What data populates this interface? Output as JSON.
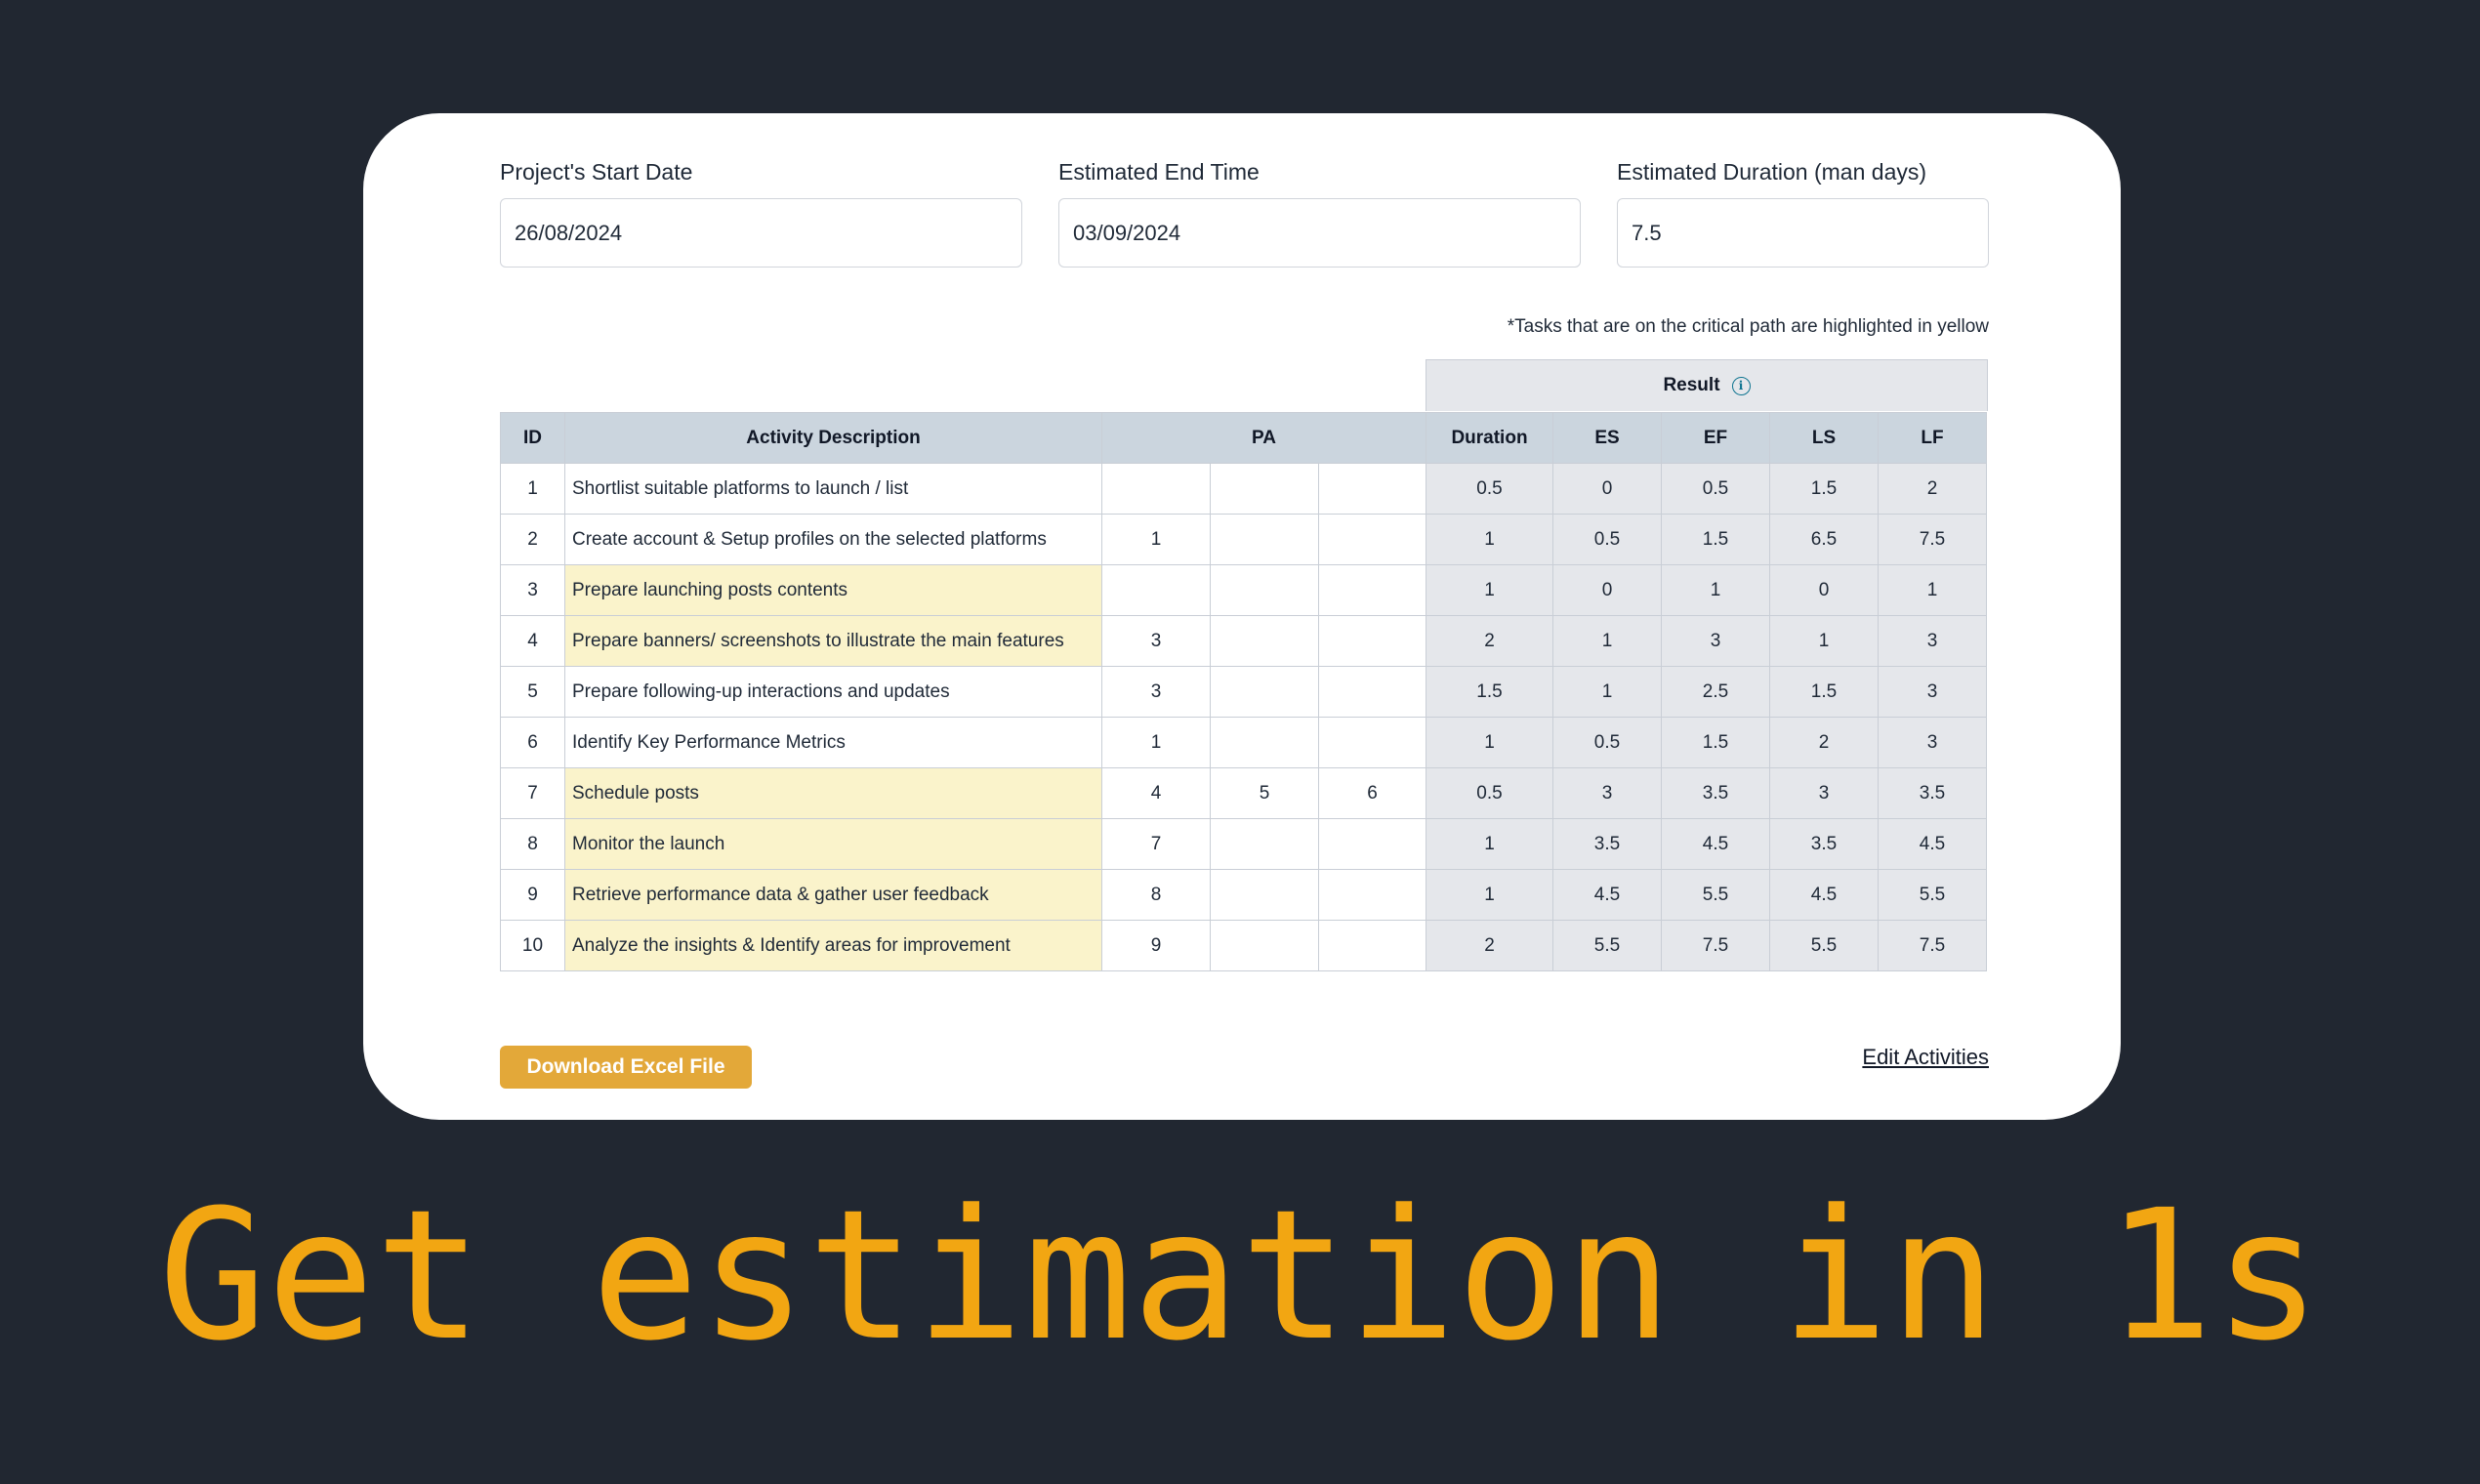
{
  "form": {
    "start_date_label": "Project's Start Date",
    "start_date_value": "26/08/2024",
    "end_time_label": "Estimated End Time",
    "end_time_value": "03/09/2024",
    "duration_label": "Estimated Duration (man days)",
    "duration_value": "7.5"
  },
  "note": "*Tasks that are on the critical path are highlighted in yellow",
  "table": {
    "result_header": "Result",
    "info_icon": "i",
    "headers": {
      "id": "ID",
      "description": "Activity Description",
      "pa": "PA",
      "duration": "Duration",
      "es": "ES",
      "ef": "EF",
      "ls": "LS",
      "lf": "LF"
    },
    "rows": [
      {
        "id": "1",
        "desc": "Shortlist suitable platforms to launch / list",
        "pa": [
          "",
          "",
          ""
        ],
        "duration": "0.5",
        "es": "0",
        "ef": "0.5",
        "ls": "1.5",
        "lf": "2",
        "critical": false
      },
      {
        "id": "2",
        "desc": "Create account & Setup profiles on the selected platforms",
        "pa": [
          "1",
          "",
          ""
        ],
        "duration": "1",
        "es": "0.5",
        "ef": "1.5",
        "ls": "6.5",
        "lf": "7.5",
        "critical": false
      },
      {
        "id": "3",
        "desc": "Prepare launching posts contents",
        "pa": [
          "",
          "",
          ""
        ],
        "duration": "1",
        "es": "0",
        "ef": "1",
        "ls": "0",
        "lf": "1",
        "critical": true
      },
      {
        "id": "4",
        "desc": "Prepare banners/ screenshots to illustrate the main features",
        "pa": [
          "3",
          "",
          ""
        ],
        "duration": "2",
        "es": "1",
        "ef": "3",
        "ls": "1",
        "lf": "3",
        "critical": true
      },
      {
        "id": "5",
        "desc": "Prepare following-up interactions and updates",
        "pa": [
          "3",
          "",
          ""
        ],
        "duration": "1.5",
        "es": "1",
        "ef": "2.5",
        "ls": "1.5",
        "lf": "3",
        "critical": false
      },
      {
        "id": "6",
        "desc": "Identify Key Performance Metrics",
        "pa": [
          "1",
          "",
          ""
        ],
        "duration": "1",
        "es": "0.5",
        "ef": "1.5",
        "ls": "2",
        "lf": "3",
        "critical": false
      },
      {
        "id": "7",
        "desc": "Schedule posts",
        "pa": [
          "4",
          "5",
          "6"
        ],
        "duration": "0.5",
        "es": "3",
        "ef": "3.5",
        "ls": "3",
        "lf": "3.5",
        "critical": true
      },
      {
        "id": "8",
        "desc": "Monitor the launch",
        "pa": [
          "7",
          "",
          ""
        ],
        "duration": "1",
        "es": "3.5",
        "ef": "4.5",
        "ls": "3.5",
        "lf": "4.5",
        "critical": true
      },
      {
        "id": "9",
        "desc": "Retrieve performance data & gather user feedback",
        "pa": [
          "8",
          "",
          ""
        ],
        "duration": "1",
        "es": "4.5",
        "ef": "5.5",
        "ls": "4.5",
        "lf": "5.5",
        "critical": true
      },
      {
        "id": "10",
        "desc": "Analyze the insights & Identify areas for improvement",
        "pa": [
          "9",
          "",
          ""
        ],
        "duration": "2",
        "es": "5.5",
        "ef": "7.5",
        "ls": "5.5",
        "lf": "7.5",
        "critical": true
      }
    ]
  },
  "actions": {
    "download_label": "Download Excel File",
    "edit_label": "Edit Activities"
  },
  "headline": "Get estimation in 1s",
  "colors": {
    "background": "#212731",
    "accent": "#f2a612",
    "button": "#e3a839",
    "critical_highlight": "#faf3cb",
    "result_column": "#e5e7eb",
    "header_row": "#cbd5de"
  }
}
